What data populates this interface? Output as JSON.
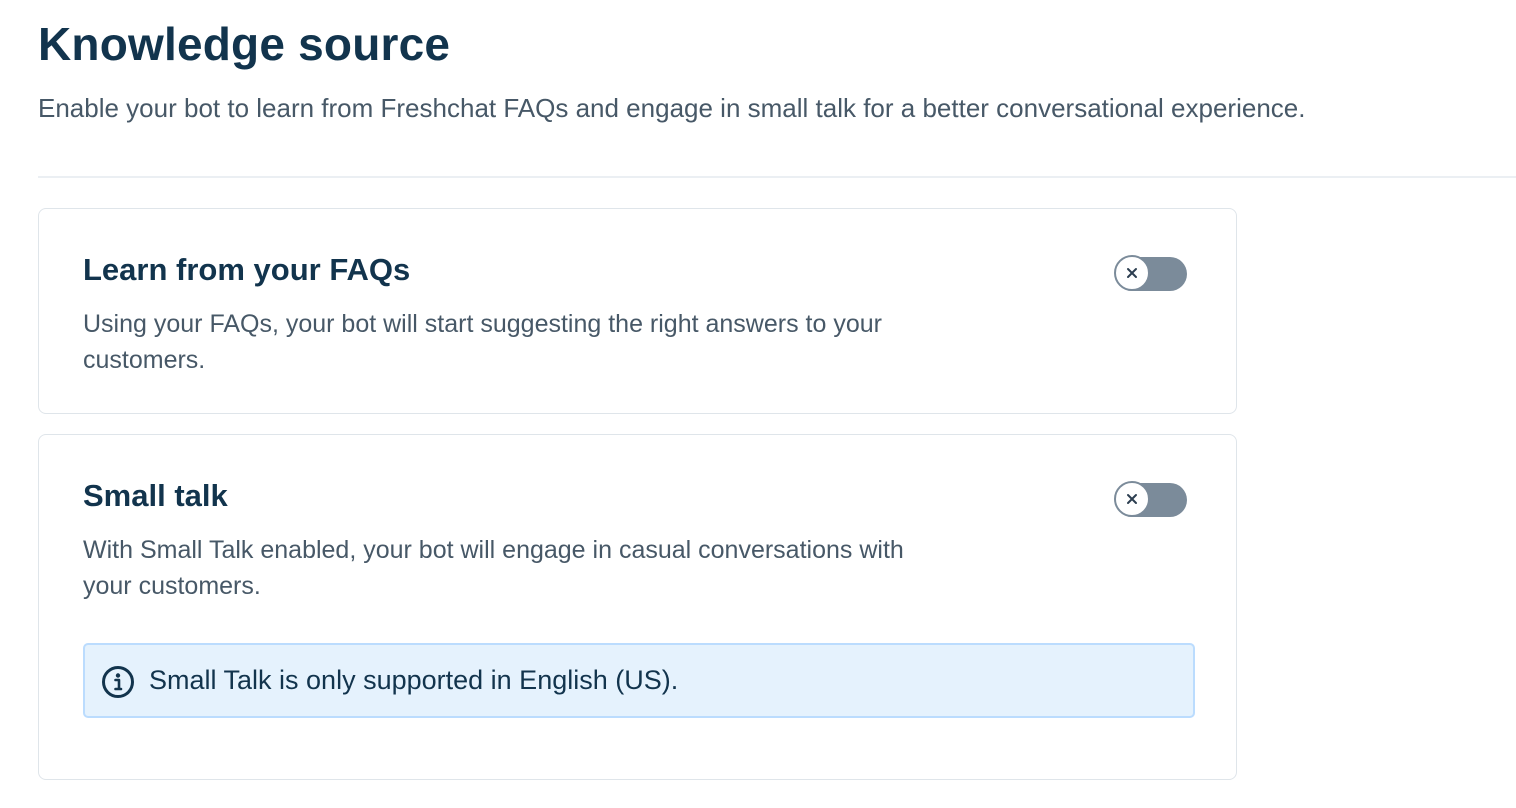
{
  "header": {
    "title": "Knowledge source",
    "description": "Enable your bot to learn from Freshchat FAQs and engage in small talk for a better conversational experience."
  },
  "cards": {
    "faqs": {
      "title": "Learn from your FAQs",
      "description": "Using your FAQs, your bot will start suggesting the right answers to your customers.",
      "toggle_state": "off",
      "toggle_icon": "close-icon"
    },
    "small_talk": {
      "title": "Small talk",
      "description": "With Small Talk enabled, your bot will engage in casual conversations with your customers.",
      "toggle_state": "off",
      "toggle_icon": "close-icon",
      "notice": {
        "icon": "info-icon",
        "text": "Small Talk is only supported in English (US)."
      }
    }
  },
  "colors": {
    "heading": "#12344d",
    "body_text": "#475867",
    "toggle_off": "#7b8b9a",
    "info_background": "#e5f2fd",
    "info_border": "#bbdcfe"
  }
}
